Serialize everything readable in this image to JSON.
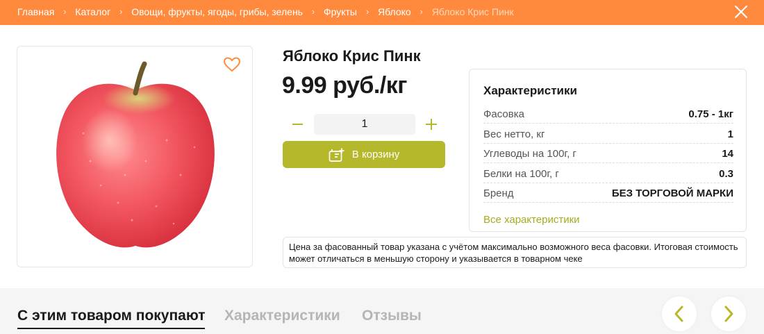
{
  "breadcrumb": {
    "items": [
      "Главная",
      "Каталог",
      "Овощи, фрукты, ягоды, грибы, зелень",
      "Фрукты",
      "Яблоко"
    ],
    "current": "Яблоко Крис Пинк",
    "separator": "›"
  },
  "product": {
    "title": "Яблоко Крис Пинк",
    "price": "9.99 руб./кг",
    "quantity": "1",
    "add_to_cart_label": "В корзину"
  },
  "specs": {
    "title": "Характеристики",
    "rows": [
      {
        "label": "Фасовка",
        "value": "0.75 - 1кг"
      },
      {
        "label": "Вес нетто, кг",
        "value": "1"
      },
      {
        "label": "Углеводы на 100г, г",
        "value": "14"
      },
      {
        "label": "Белки на 100г, г",
        "value": "0.3"
      },
      {
        "label": "Бренд",
        "value": "БЕЗ ТОРГОВОЙ МАРКИ"
      }
    ],
    "all_link": "Все характеристики"
  },
  "note": "Цена за фасованный товар указана с учётом максимально возможного веса фасовки. Итоговая стоимость может отличаться в меньшую сторону и указывается в товарном чеке",
  "tabs": [
    {
      "label": "С этим товаром покупают",
      "active": true
    },
    {
      "label": "Характеристики",
      "active": false
    },
    {
      "label": "Отзывы",
      "active": false
    }
  ],
  "icons": {
    "close": "close-icon",
    "favorite": "heart-icon",
    "minus": "minus-icon",
    "plus": "plus-icon",
    "cart": "cart-add-icon",
    "prev": "chevron-left-icon",
    "next": "chevron-right-icon"
  },
  "colors": {
    "header": "#ff8a3d",
    "accent": "#b5b82a",
    "link": "#a7ab1e",
    "heart": "#ff8a3d"
  }
}
